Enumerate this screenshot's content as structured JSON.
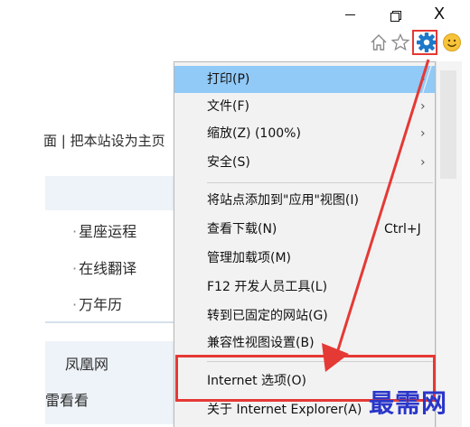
{
  "window": {
    "minimize_glyph": "",
    "close_glyph": "X"
  },
  "toolbar": {
    "icons": [
      "home-icon",
      "favorites-star-icon",
      "gear-icon",
      "smiley-feedback-icon"
    ],
    "highlight_color": "#e53935"
  },
  "page": {
    "homepage_link": "面 | 把本站设为主页",
    "services": [
      "星座运程",
      "在线翻译",
      "万年历"
    ],
    "sites": [
      "凤凰网",
      "雷看看"
    ]
  },
  "tools_menu": {
    "items": [
      {
        "label": "打印(P)",
        "submenu": true,
        "hover": true
      },
      {
        "label": "文件(F)",
        "submenu": true
      },
      {
        "label": "缩放(Z) (100%)",
        "submenu": true
      },
      {
        "label": "安全(S)",
        "submenu": true
      },
      {
        "label": "将站点添加到\"应用\"视图(I)"
      },
      {
        "label": "查看下载(N)",
        "shortcut": "Ctrl+J"
      },
      {
        "label": "管理加载项(M)"
      },
      {
        "label": "F12 开发人员工具(L)"
      },
      {
        "label": "转到已固定的网站(G)"
      },
      {
        "label": "兼容性视图设置(B)"
      },
      {
        "label": "Internet 选项(O)",
        "highlighted": true
      },
      {
        "label": "关于 Internet Explorer(A)"
      }
    ],
    "submenu_glyph": "›",
    "hover_color": "#91c9f7"
  },
  "watermark": "最需网",
  "colors": {
    "annotation_red": "#e53935",
    "watermark_blue": "#2a36c9",
    "gear_blue": "#1e78c8"
  }
}
